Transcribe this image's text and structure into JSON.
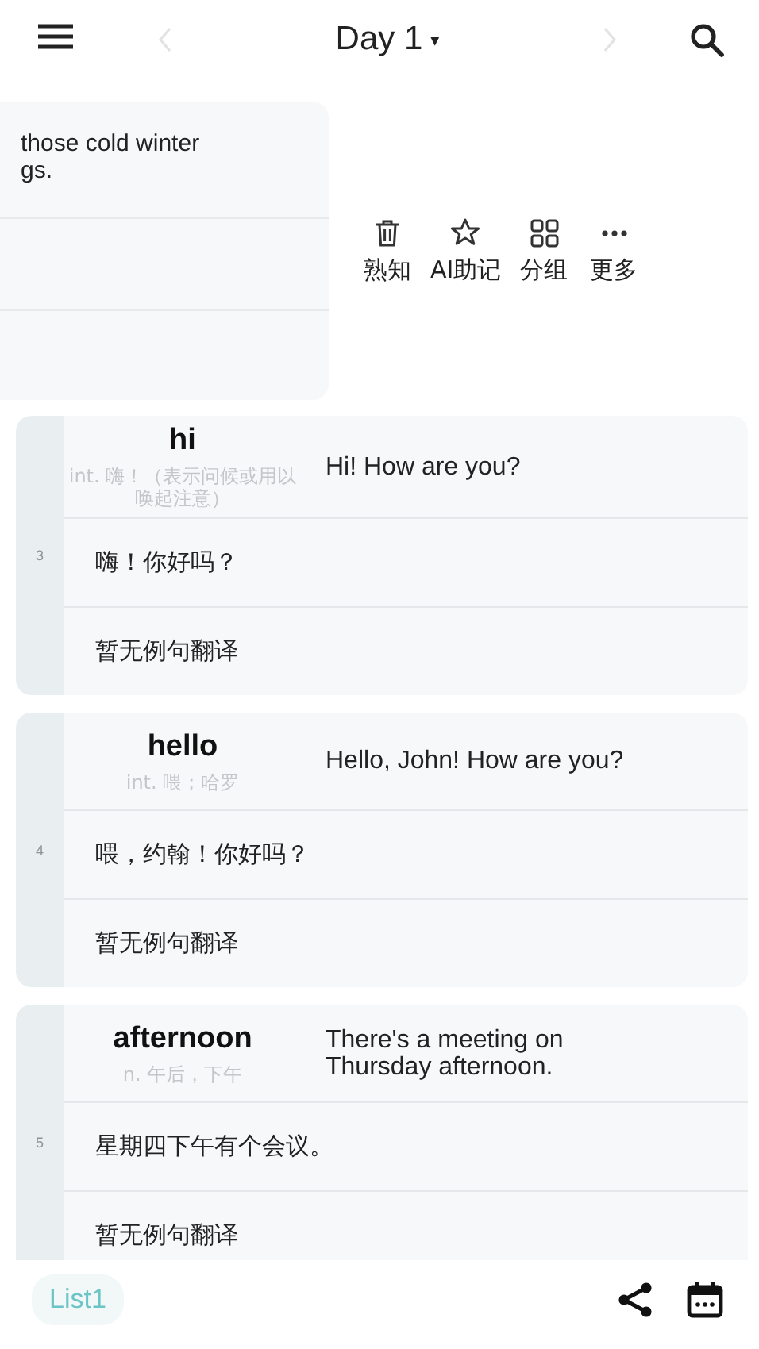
{
  "top_bar": {
    "title": "Day 1",
    "dropdown_caret": "▾",
    "prev_disabled": true,
    "next_disabled": true
  },
  "swiped_card": {
    "sentence_lines": [
      "those cold winter",
      "gs."
    ],
    "actions": [
      {
        "kind": "trash",
        "label": "熟知"
      },
      {
        "kind": "star",
        "label": "AI助记"
      },
      {
        "kind": "grid",
        "label": "分组"
      },
      {
        "kind": "dots",
        "label": "更多"
      }
    ]
  },
  "words": [
    {
      "number": "3",
      "word": "hi",
      "meaning": "int. 嗨！（表示问候或用以唤起注意）",
      "sentence": "Hi! How are you?",
      "sentence_translation": "嗨！你好吗？",
      "note": "暂无例句翻译"
    },
    {
      "number": "4",
      "word": "hello",
      "meaning": "int. 喂；哈罗",
      "sentence": "Hello, John! How are you?",
      "sentence_translation": "喂，约翰！你好吗？",
      "note": "暂无例句翻译"
    },
    {
      "number": "5",
      "word": "afternoon",
      "meaning": "n. 午后，下午",
      "sentence": "There's a meeting on Thursday afternoon.",
      "sentence_translation": "星期四下午有个会议。",
      "note": "暂无例句翻译"
    }
  ],
  "bottom_bar": {
    "list_chip": "List1"
  }
}
